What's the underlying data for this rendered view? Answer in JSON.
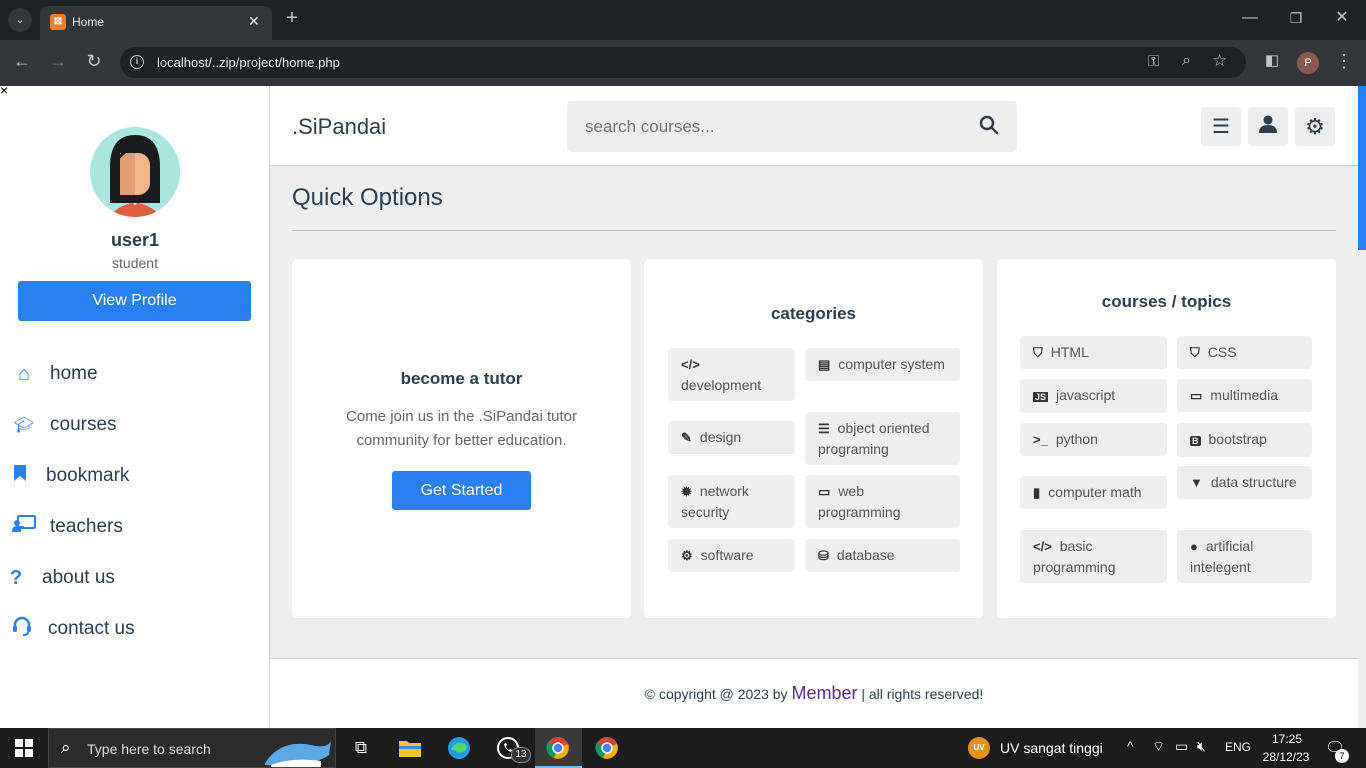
{
  "browser": {
    "tab_title": "Home",
    "url": "localhost/..zip/project/home.php",
    "profile_letter": "P"
  },
  "sidebar": {
    "close": "×",
    "user_name": "user1",
    "user_role": "student",
    "profile_button": "View Profile",
    "nav": [
      {
        "label": "home",
        "icon": "home-icon"
      },
      {
        "label": "courses",
        "icon": "graduation-cap-icon"
      },
      {
        "label": "bookmark",
        "icon": "bookmark-icon"
      },
      {
        "label": "teachers",
        "icon": "chalkboard-teacher-icon"
      },
      {
        "label": "about us",
        "icon": "question-icon"
      },
      {
        "label": "contact us",
        "icon": "headset-icon"
      }
    ]
  },
  "header": {
    "logo": ".SiPandai",
    "search_placeholder": "search courses..."
  },
  "main": {
    "heading": "Quick Options",
    "tutor": {
      "title": "become a tutor",
      "text": "Come join us in the .SiPandai tutor community for better education.",
      "button": "Get Started"
    },
    "categories": {
      "title": "categories",
      "items": [
        {
          "label": "development",
          "icon": "code-icon"
        },
        {
          "label": "computer system",
          "icon": "server-icon"
        },
        {
          "label": "design",
          "icon": "pen-icon"
        },
        {
          "label": "object oriented programing",
          "icon": "list-icon"
        },
        {
          "label": "network security",
          "icon": "bug-icon"
        },
        {
          "label": "web programming",
          "icon": "laptop-icon"
        },
        {
          "label": "software",
          "icon": "cog-icon"
        },
        {
          "label": "database",
          "icon": "database-icon"
        }
      ]
    },
    "topics": {
      "title": "courses / topics",
      "items": [
        {
          "label": "HTML",
          "icon": "html5-icon"
        },
        {
          "label": "CSS",
          "icon": "css3-icon"
        },
        {
          "label": "javascript",
          "icon": "js-icon"
        },
        {
          "label": "multimedia",
          "icon": "desktop-icon"
        },
        {
          "label": "python",
          "icon": "terminal-icon"
        },
        {
          "label": "bootstrap",
          "icon": "bootstrap-icon"
        },
        {
          "label": "computer math",
          "icon": "file-icon"
        },
        {
          "label": "data structure",
          "icon": "filter-icon"
        },
        {
          "label": "basic programming",
          "icon": "code-icon"
        },
        {
          "label": "artificial intelegent",
          "icon": "comment-icon"
        }
      ]
    }
  },
  "footer": {
    "prefix": "© copyright @ 2023 by",
    "brand": "Member",
    "suffix": "| all rights reserved!"
  },
  "taskbar": {
    "search_placeholder": "Type here to search",
    "whatsapp_badge": "13",
    "weather": "UV sangat tinggi",
    "uv_badge": "UV",
    "lang": "ENG",
    "time": "17:25",
    "date": "28/12/23",
    "notif_count": "7"
  },
  "colors": {
    "accent": "#2980f0",
    "text_dark": "#2c3e50",
    "brand_purple": "#5b2c8f"
  }
}
